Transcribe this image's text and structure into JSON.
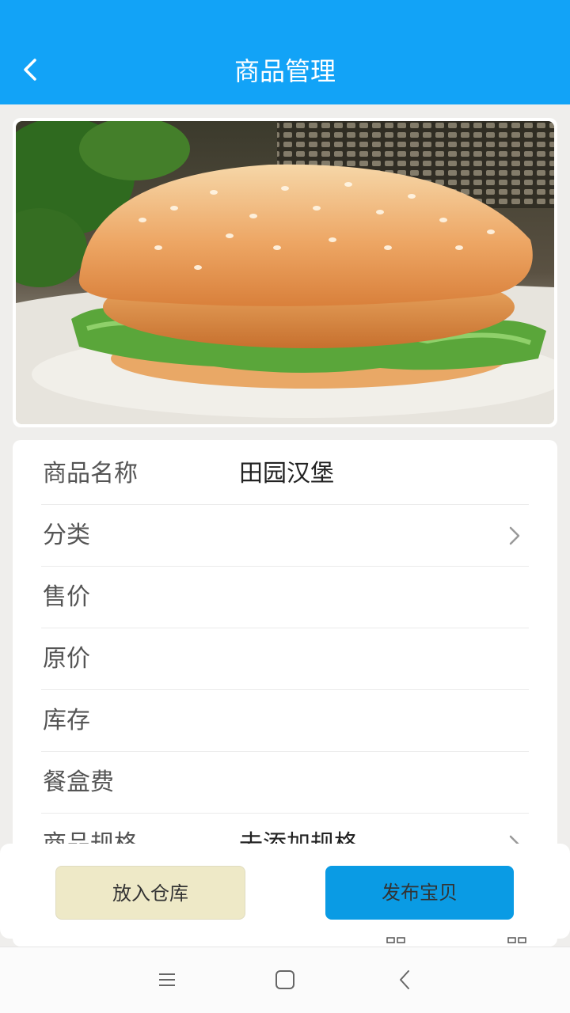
{
  "theme": {
    "accent": "#12a3f7"
  },
  "header": {
    "title": "商品管理",
    "back_icon": "chevron-left-icon"
  },
  "product_image": {
    "subject": "burger"
  },
  "form": {
    "rows": [
      {
        "label": "商品名称",
        "value": "田园汉堡"
      },
      {
        "label": "分类",
        "value": ""
      },
      {
        "label": "售价",
        "value": ""
      },
      {
        "label": "原价",
        "value": ""
      },
      {
        "label": "库存",
        "value": ""
      },
      {
        "label": "餐盒费",
        "value": ""
      },
      {
        "label": "商品规格",
        "value": "去添加规格"
      }
    ]
  },
  "actions": {
    "warehouse_label": "放入仓库",
    "publish_label": "发布宝贝"
  },
  "system_nav": {
    "icons": [
      "menu-icon",
      "home-square-icon",
      "back-triangle-icon"
    ]
  }
}
